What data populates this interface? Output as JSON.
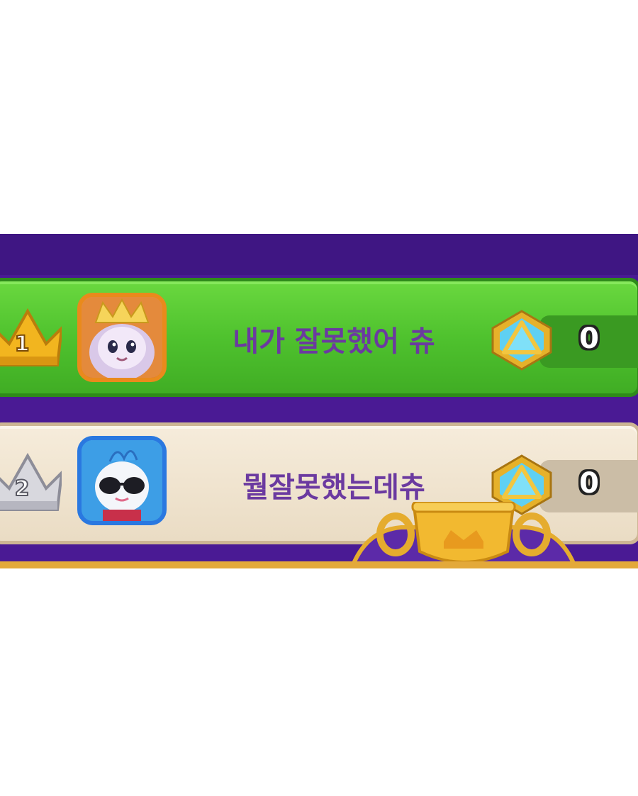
{
  "leaderboard": {
    "rows": [
      {
        "rank": "1",
        "name": "내가 잘못했어 츄",
        "score": "0",
        "crown": "gold-crown-icon",
        "avatar": "queen-character-avatar"
      },
      {
        "rank": "2",
        "name": "뭘잘못했는데츄",
        "score": "0",
        "crown": "silver-crown-icon",
        "avatar": "sunglasses-bird-avatar"
      }
    ],
    "score_icon": "blue-gem-icon",
    "decoration": "gold-trophy-icon"
  },
  "colors": {
    "panel": "#4a1a94",
    "row1_bg": "#4fc22e",
    "row2_bg": "#eadcc4",
    "name_text": "#6b3aa0"
  }
}
